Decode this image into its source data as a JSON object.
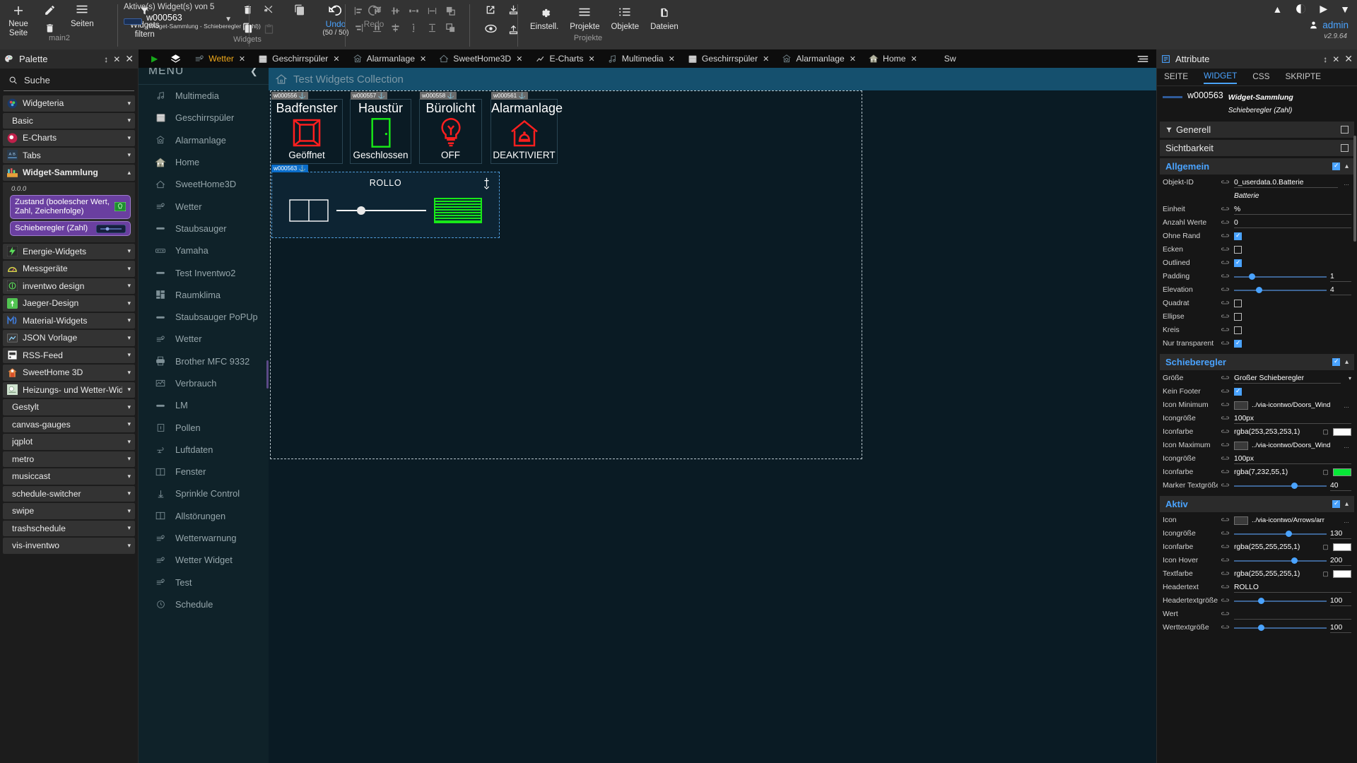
{
  "toolbar": {
    "pages_group": {
      "label": "main2",
      "new_page": "Neue\nSeite",
      "edit_icon": "pencil-icon",
      "delete_icon": "trash-icon",
      "pages": "Seiten"
    },
    "widgets_group": {
      "label": "Widgets",
      "filter": "Widgets\nfiltern",
      "active_title": "Aktive(s) Widget(s) von 5",
      "active_name": "w000563",
      "active_sub": "(Widget-Sammlung - Schieberegler (Zahl))",
      "undo": "Undo",
      "undo_count": "(50 / 50)",
      "redo": "Redo"
    },
    "projects_group": {
      "label": "Projekte",
      "items": [
        {
          "label": "Einstell.",
          "icon": "gear-icon"
        },
        {
          "label": "Projekte",
          "icon": "list-icon"
        },
        {
          "label": "Objekte",
          "icon": "bullet-list-icon"
        },
        {
          "label": "Dateien",
          "icon": "files-icon"
        }
      ]
    },
    "account": {
      "name": "admin",
      "version": "v2.9.64"
    }
  },
  "palette": {
    "title": "Palette",
    "search_placeholder": "Suche",
    "items": [
      {
        "label": "Widgeteria",
        "icon": "widgeteria-icon",
        "chevron": "▾",
        "bold": false
      },
      {
        "label": "Basic",
        "icon": "none",
        "chevron": "▾",
        "bold": false
      },
      {
        "label": "E-Charts",
        "icon": "echarts-icon",
        "chevron": "▾",
        "bold": false
      },
      {
        "label": "Tabs",
        "icon": "tabs-icon",
        "chevron": "▾",
        "bold": false
      },
      {
        "label": "Widget-Sammlung",
        "icon": "collection-icon",
        "chevron": "▴",
        "bold": true
      },
      {
        "label": "Energie-Widgets",
        "icon": "energy-icon",
        "chevron": "▾",
        "bold": false
      },
      {
        "label": "Messgeräte",
        "icon": "gauge-icon",
        "chevron": "▾",
        "bold": false
      },
      {
        "label": "inventwo design",
        "icon": "inventwo-icon",
        "chevron": "▾",
        "bold": false
      },
      {
        "label": "Jaeger-Design",
        "icon": "jaeger-icon",
        "chevron": "▾",
        "bold": false
      },
      {
        "label": "Material-Widgets",
        "icon": "material-icon",
        "chevron": "▾",
        "bold": false
      },
      {
        "label": "JSON Vorlage",
        "icon": "json-icon",
        "chevron": "▾",
        "bold": false
      },
      {
        "label": "RSS-Feed",
        "icon": "rss-icon",
        "chevron": "▾",
        "bold": false
      },
      {
        "label": "SweetHome 3D",
        "icon": "sweethome-icon",
        "chevron": "▾",
        "bold": false
      },
      {
        "label": "Heizungs- und Wetter-Widgets",
        "icon": "weather-icon",
        "chevron": "▾",
        "bold": false
      },
      {
        "label": "Gestylt",
        "icon": "none",
        "chevron": "▾",
        "bold": false
      },
      {
        "label": "canvas-gauges",
        "icon": "none",
        "chevron": "▾",
        "bold": false
      },
      {
        "label": "jqplot",
        "icon": "none",
        "chevron": "▾",
        "bold": false
      },
      {
        "label": "metro",
        "icon": "none",
        "chevron": "▾",
        "bold": false
      },
      {
        "label": "musiccast",
        "icon": "none",
        "chevron": "▾",
        "bold": false
      },
      {
        "label": "schedule-switcher",
        "icon": "none",
        "chevron": "▾",
        "bold": false
      },
      {
        "label": "swipe",
        "icon": "none",
        "chevron": "▾",
        "bold": false
      },
      {
        "label": "trashschedule",
        "icon": "none",
        "chevron": "▾",
        "bold": false
      },
      {
        "label": "vis-inventwo",
        "icon": "none",
        "chevron": "▾",
        "bold": false
      }
    ],
    "expanded_group": {
      "version": "0.0.0",
      "widgets": [
        {
          "label": "Zustand (boolescher Wert, Zahl, Zeichenfolge)",
          "preview": "bulb"
        },
        {
          "label": "Schieberegler (Zahl)",
          "preview": "slider"
        }
      ]
    }
  },
  "menu": {
    "header": "MENÜ",
    "items": [
      {
        "label": "Multimedia",
        "icon": "music-note-icon"
      },
      {
        "label": "Geschirrspüler",
        "icon": "dishwasher-icon"
      },
      {
        "label": "Alarmanlage",
        "icon": "alarm-icon"
      },
      {
        "label": "Home",
        "icon": "house-icon"
      },
      {
        "label": "SweetHome3D",
        "icon": "home-outline-icon"
      },
      {
        "label": "Wetter",
        "icon": "weather-icon"
      },
      {
        "label": "Staubsauger",
        "icon": "vacuum-icon"
      },
      {
        "label": "Yamaha",
        "icon": "receiver-icon"
      },
      {
        "label": "Test Inventwo2",
        "icon": "vacuum-icon"
      },
      {
        "label": "Raumklima",
        "icon": "tiles-icon"
      },
      {
        "label": "Staubsauger PoPUp",
        "icon": "vacuum-icon"
      },
      {
        "label": "Wetter",
        "icon": "weather-icon"
      },
      {
        "label": "Brother MFC 9332",
        "icon": "printer-icon"
      },
      {
        "label": "Verbrauch",
        "icon": "chart-icon"
      },
      {
        "label": "LM",
        "icon": "vacuum-icon"
      },
      {
        "label": "Pollen",
        "icon": "info-box-icon"
      },
      {
        "label": "Luftdaten",
        "icon": "airsensor-icon"
      },
      {
        "label": "Fenster",
        "icon": "window-icon"
      },
      {
        "label": "Sprinkle Control",
        "icon": "sprinkler-icon"
      },
      {
        "label": "Allstörungen",
        "icon": "window-icon"
      },
      {
        "label": "Wetterwarnung",
        "icon": "weather-icon"
      },
      {
        "label": "Wetter Widget",
        "icon": "weather-icon"
      },
      {
        "label": "Test",
        "icon": "weather-icon"
      },
      {
        "label": "Schedule",
        "icon": "clock-icon"
      }
    ]
  },
  "editor_tabs": {
    "play_icon": "play-icon",
    "layers_icon": "layers-icon",
    "burger_icon": "burger-icon",
    "tabs": [
      {
        "label": "Wetter",
        "icon": "weather-icon",
        "active": true
      },
      {
        "label": "Geschirrspüler",
        "icon": "dishwasher-icon",
        "active": false
      },
      {
        "label": "Alarmanlage",
        "icon": "alarm-icon",
        "active": false
      },
      {
        "label": "SweetHome3D",
        "icon": "home-outline-icon",
        "active": false
      },
      {
        "label": "E-Charts",
        "icon": "chart-line-icon",
        "active": false
      },
      {
        "label": "Multimedia",
        "icon": "music-note-icon",
        "active": false
      },
      {
        "label": "Geschirrspüler",
        "icon": "dishwasher-icon",
        "active": false
      },
      {
        "label": "Alarmanlage",
        "icon": "alarm-icon",
        "active": false
      },
      {
        "label": "Home",
        "icon": "house-icon",
        "active": false
      },
      {
        "label": "Sw",
        "icon": "none",
        "active": false
      }
    ]
  },
  "canvas": {
    "view_title": "Test Widgets Collection",
    "view_icon": "house-icon",
    "tiles": [
      {
        "id": "w000556",
        "name": "Badfenster",
        "state": "Geöffnet",
        "icon": "window-open-icon",
        "color": "#ff1f1f"
      },
      {
        "id": "w000557",
        "name": "Haustür",
        "state": "Geschlossen",
        "icon": "door-closed-icon",
        "color": "#18e818"
      },
      {
        "id": "w000558",
        "name": "Bürolicht",
        "state": "OFF",
        "icon": "bulb-icon",
        "color": "#ff1f1f"
      },
      {
        "id": "w000561",
        "name": "Alarmanlage",
        "state": "DEAKTIVIERT",
        "icon": "alarm-bell-icon",
        "color": "#ff1f1f"
      }
    ],
    "rollo": {
      "id": "w000563",
      "title": "ROLLO",
      "anchor_icon": "anchor-icon",
      "min_icon": "window-icon",
      "max_icon": "blinds-icon",
      "slider_value": 25
    }
  },
  "attributes": {
    "title": "Attribute",
    "tabs": [
      {
        "label": "SEITE",
        "active": false
      },
      {
        "label": "WIDGET",
        "active": true
      },
      {
        "label": "CSS",
        "active": false
      },
      {
        "label": "SKRIPTE",
        "active": false
      }
    ],
    "widget_id": "w000563",
    "widget_set": "Widget-Sammlung",
    "widget_type": "Schieberegler (Zahl)",
    "sections": [
      {
        "name": "Generell",
        "checkbox": false,
        "accent": false
      },
      {
        "name": "Sichtbarkeit",
        "checkbox": false,
        "accent": false
      }
    ],
    "allgemein": {
      "title": "Allgemein",
      "checked": true,
      "rows": [
        {
          "key": "Objekt-ID",
          "type": "text",
          "value": "0_userdata.0.Batterie",
          "dots": "..."
        },
        {
          "key": "",
          "type": "italic",
          "value": "Batterie"
        },
        {
          "key": "Einheit",
          "type": "text",
          "value": "%"
        },
        {
          "key": "Anzahl Werte",
          "type": "text",
          "value": "0"
        },
        {
          "key": "Ohne Rand",
          "type": "checkbox",
          "value": true
        },
        {
          "key": "Ecken",
          "type": "checkbox",
          "value": false
        },
        {
          "key": "Outlined",
          "type": "checkbox",
          "value": true
        },
        {
          "key": "Padding",
          "type": "slider",
          "value": "1",
          "pct": 16
        },
        {
          "key": "Elevation",
          "type": "slider",
          "value": "4",
          "pct": 24
        },
        {
          "key": "Quadrat",
          "type": "checkbox",
          "value": false
        },
        {
          "key": "Ellipse",
          "type": "checkbox",
          "value": false
        },
        {
          "key": "Kreis",
          "type": "checkbox",
          "value": false
        },
        {
          "key": "Nur transparent",
          "type": "checkbox",
          "value": true
        }
      ]
    },
    "schieberegler": {
      "title": "Schieberegler",
      "checked": true,
      "rows": [
        {
          "key": "Größe",
          "type": "select",
          "value": "Großer Schieberegler"
        },
        {
          "key": "Kein Footer",
          "type": "checkbox",
          "value": true
        },
        {
          "key": "Icon Minimum",
          "type": "image",
          "value": "../via-icontwo/Doors_Wind",
          "dots": "..."
        },
        {
          "key": "Icongröße",
          "type": "text",
          "value": "100px"
        },
        {
          "key": "Iconfarbe",
          "type": "color",
          "value": "rgba(253,253,253,1)",
          "swatch": "#fdfdfd"
        },
        {
          "key": "Icon Maximum",
          "type": "image",
          "value": "../via-icontwo/Doors_Wind",
          "dots": "..."
        },
        {
          "key": "Icongröße",
          "type": "text",
          "value": "100px"
        },
        {
          "key": "Iconfarbe",
          "type": "color",
          "value": "rgba(7,232,55,1)",
          "swatch": "#07e837"
        },
        {
          "key": "Marker Textgröße",
          "type": "slider",
          "value": "40",
          "pct": 62
        }
      ]
    },
    "aktiv": {
      "title": "Aktiv",
      "checked": true,
      "rows": [
        {
          "key": "Icon",
          "type": "image",
          "value": "../via-icontwo/Arrows/arr",
          "dots": "..."
        },
        {
          "key": "Icongröße",
          "type": "slider",
          "value": "130",
          "pct": 56
        },
        {
          "key": "Iconfarbe",
          "type": "color",
          "value": "rgba(255,255,255,1)",
          "swatch": "#ffffff"
        },
        {
          "key": "Icon Hover",
          "type": "slider",
          "value": "200",
          "pct": 62
        },
        {
          "key": "Textfarbe",
          "type": "color",
          "value": "rgba(255,255,255,1)",
          "swatch": "#ffffff"
        },
        {
          "key": "Headertext",
          "type": "text",
          "value": "ROLLO"
        },
        {
          "key": "Headertextgröße",
          "type": "slider",
          "value": "100",
          "pct": 26
        },
        {
          "key": "Wert",
          "type": "text",
          "value": ""
        },
        {
          "key": "Werttextgröße",
          "type": "slider",
          "value": "100",
          "pct": 26
        }
      ]
    }
  }
}
